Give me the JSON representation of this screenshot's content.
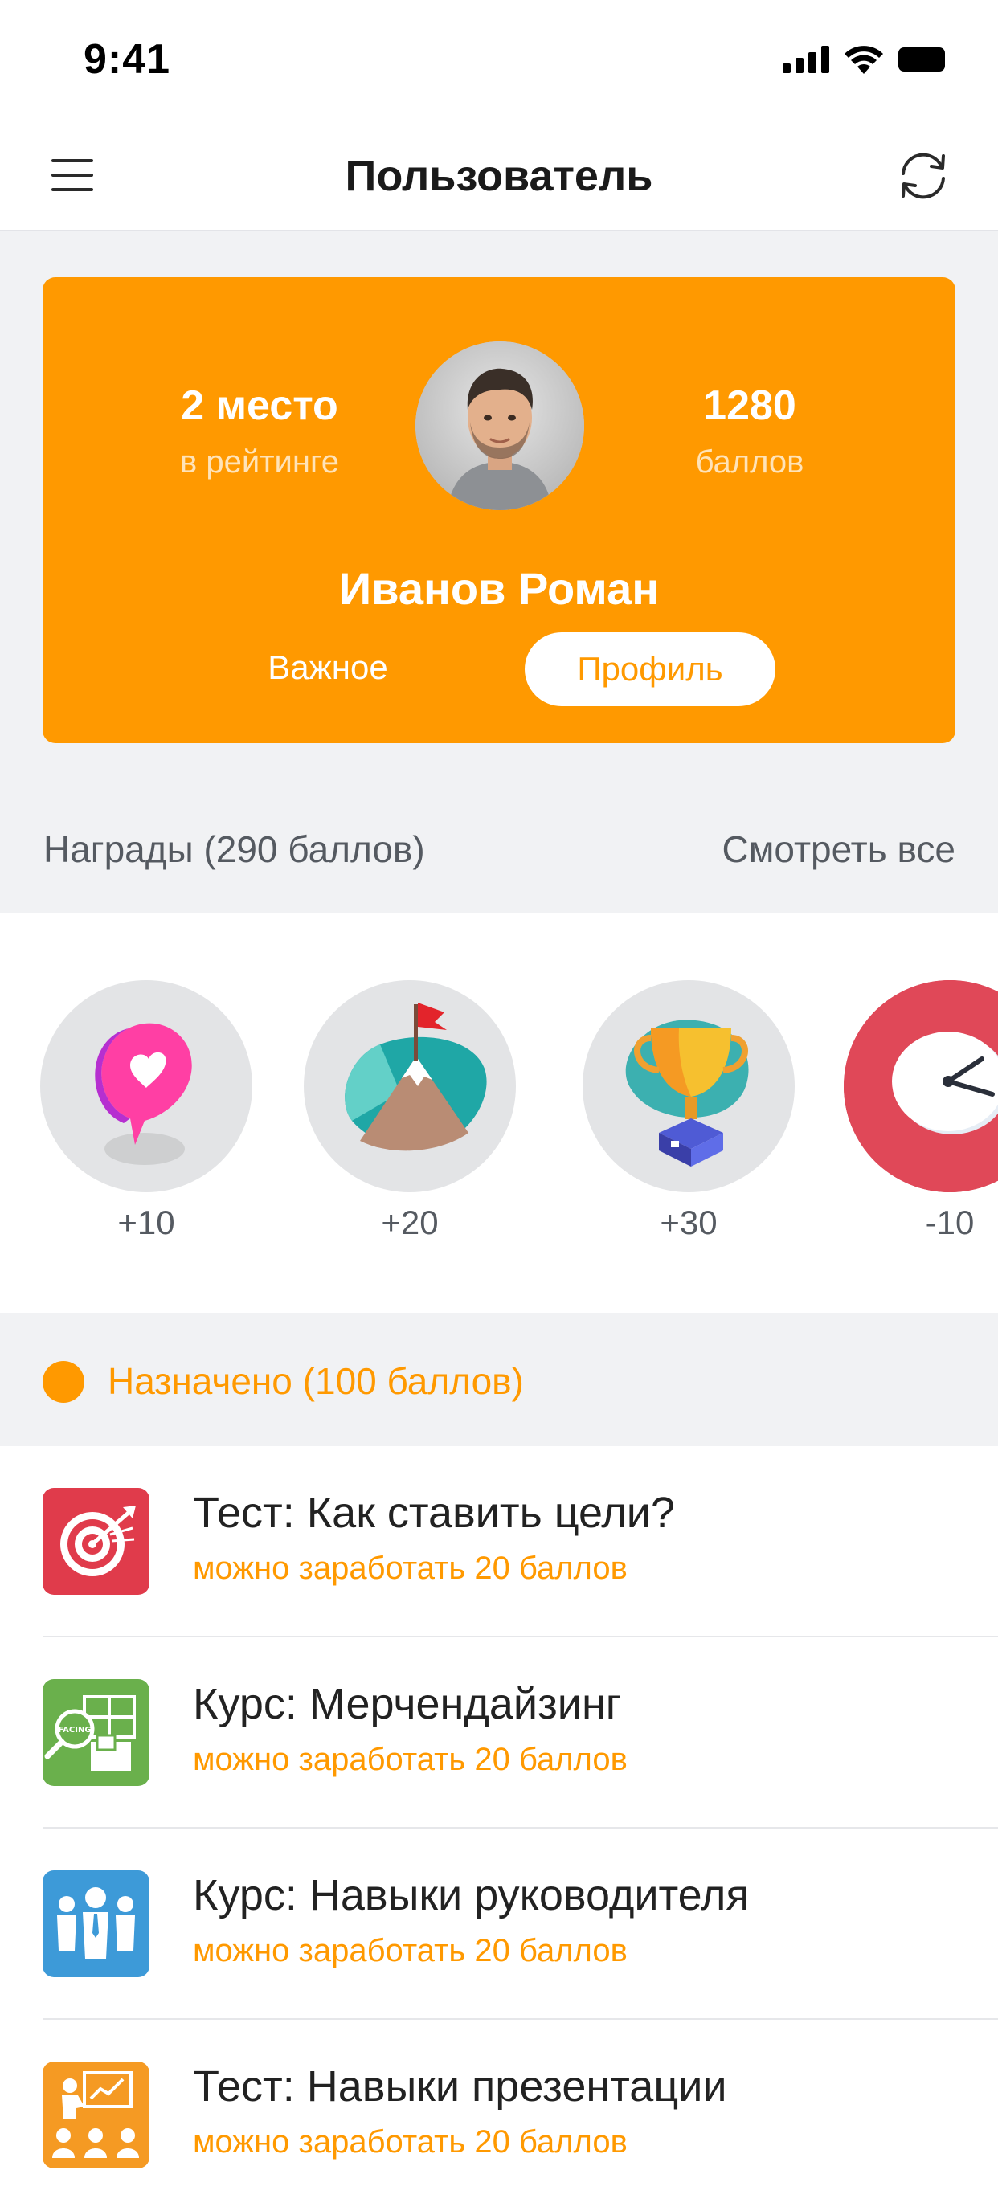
{
  "status_bar": {
    "time": "9:41"
  },
  "nav": {
    "title": "Пользователь"
  },
  "profile_card": {
    "rank_value": "2 место",
    "rank_label": "в рейтинге",
    "points_value": "1280",
    "points_label": "баллов",
    "name": "Иванов Роман",
    "important_label": "Важное",
    "profile_label": "Профиль"
  },
  "rewards": {
    "title": "Награды (290 баллов)",
    "see_all": "Смотреть все",
    "items": [
      {
        "icon": "heart-bubble-icon",
        "label": "+10"
      },
      {
        "icon": "mountain-flag-icon",
        "label": "+20"
      },
      {
        "icon": "trophy-icon",
        "label": "+30"
      },
      {
        "icon": "clock-icon",
        "label": "-10"
      }
    ]
  },
  "assigned": {
    "title": "Назначено (100 баллов)",
    "items": [
      {
        "icon": "target-icon",
        "color": "#e03b4b",
        "title": "Тест: Как ставить цели?",
        "subtitle": "можно заработать 20 баллов"
      },
      {
        "icon": "merchandising-icon",
        "color": "#6ab04c",
        "title": "Курс: Мерчендайзинг",
        "subtitle": "можно заработать 20 баллов"
      },
      {
        "icon": "team-icon",
        "color": "#3d9ad8",
        "title": "Курс: Навыки руководителя",
        "subtitle": "можно заработать 20 баллов"
      },
      {
        "icon": "presentation-icon",
        "color": "#f59a23",
        "title": "Тест: Навыки презентации",
        "subtitle": "можно заработать 20 баллов"
      }
    ]
  },
  "colors": {
    "accent": "#ff9900",
    "background": "#f1f2f4"
  }
}
